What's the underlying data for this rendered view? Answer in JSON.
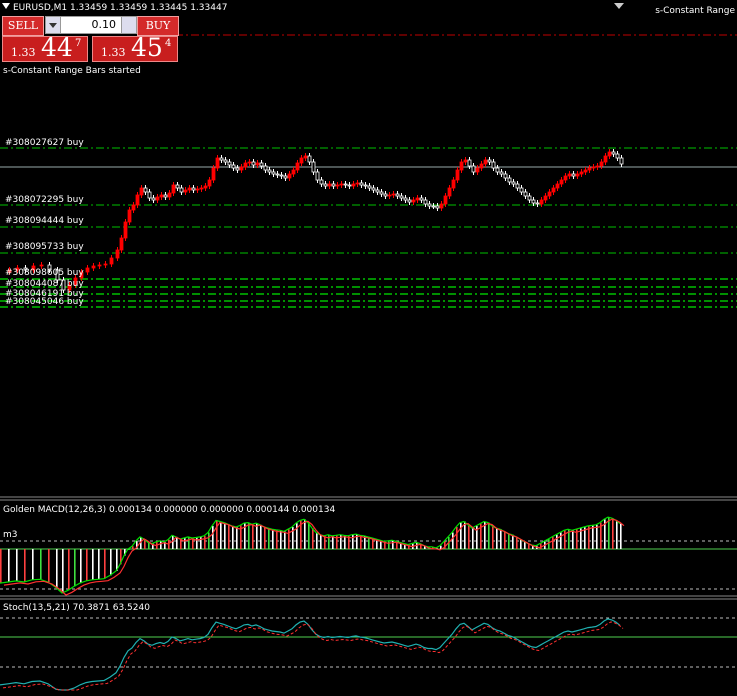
{
  "chart": {
    "symbol_line": "EURUSD,M1  1.33459 1.33459 1.33445 1.33447",
    "ea_name": "s-Constant Range",
    "ea_status": "s-Constant Range Bars started"
  },
  "trade_panel": {
    "sell_label": "SELL",
    "buy_label": "BUY",
    "lot_value": "0.10",
    "sell_price_small": "1.33",
    "sell_price_big": "44",
    "sell_price_sup": "7",
    "buy_price_small": "1.33",
    "buy_price_big": "45",
    "buy_price_sup": "4"
  },
  "orders": [
    {
      "label": "#308027627 buy"
    },
    {
      "label": "#308072295 buy"
    },
    {
      "label": "#308094444 buy"
    },
    {
      "label": "#308095733 buy"
    },
    {
      "label": "#308098605 buy"
    },
    {
      "label": "#308044087 buy"
    },
    {
      "label": "#308046191 buy"
    },
    {
      "label": "#308045046 buy"
    }
  ],
  "indicators": {
    "macd_label": "Golden MACD(12,26,3) 0.000134 0.000000 0.000000 0.000144 0.000134",
    "macd_side_label": "m3",
    "stoch_label": "Stoch(13,5,21) 70.3871 63.5240"
  },
  "colors": {
    "bull_candle": "#ff0000",
    "bear_candle": "#ffffff",
    "order_line": "#00c000",
    "sl_line": "#c00000",
    "level_line": "#4fd04f"
  },
  "icons": {
    "dropdown": "triangle-down-icon",
    "menu": "triangle-down-icon"
  }
}
